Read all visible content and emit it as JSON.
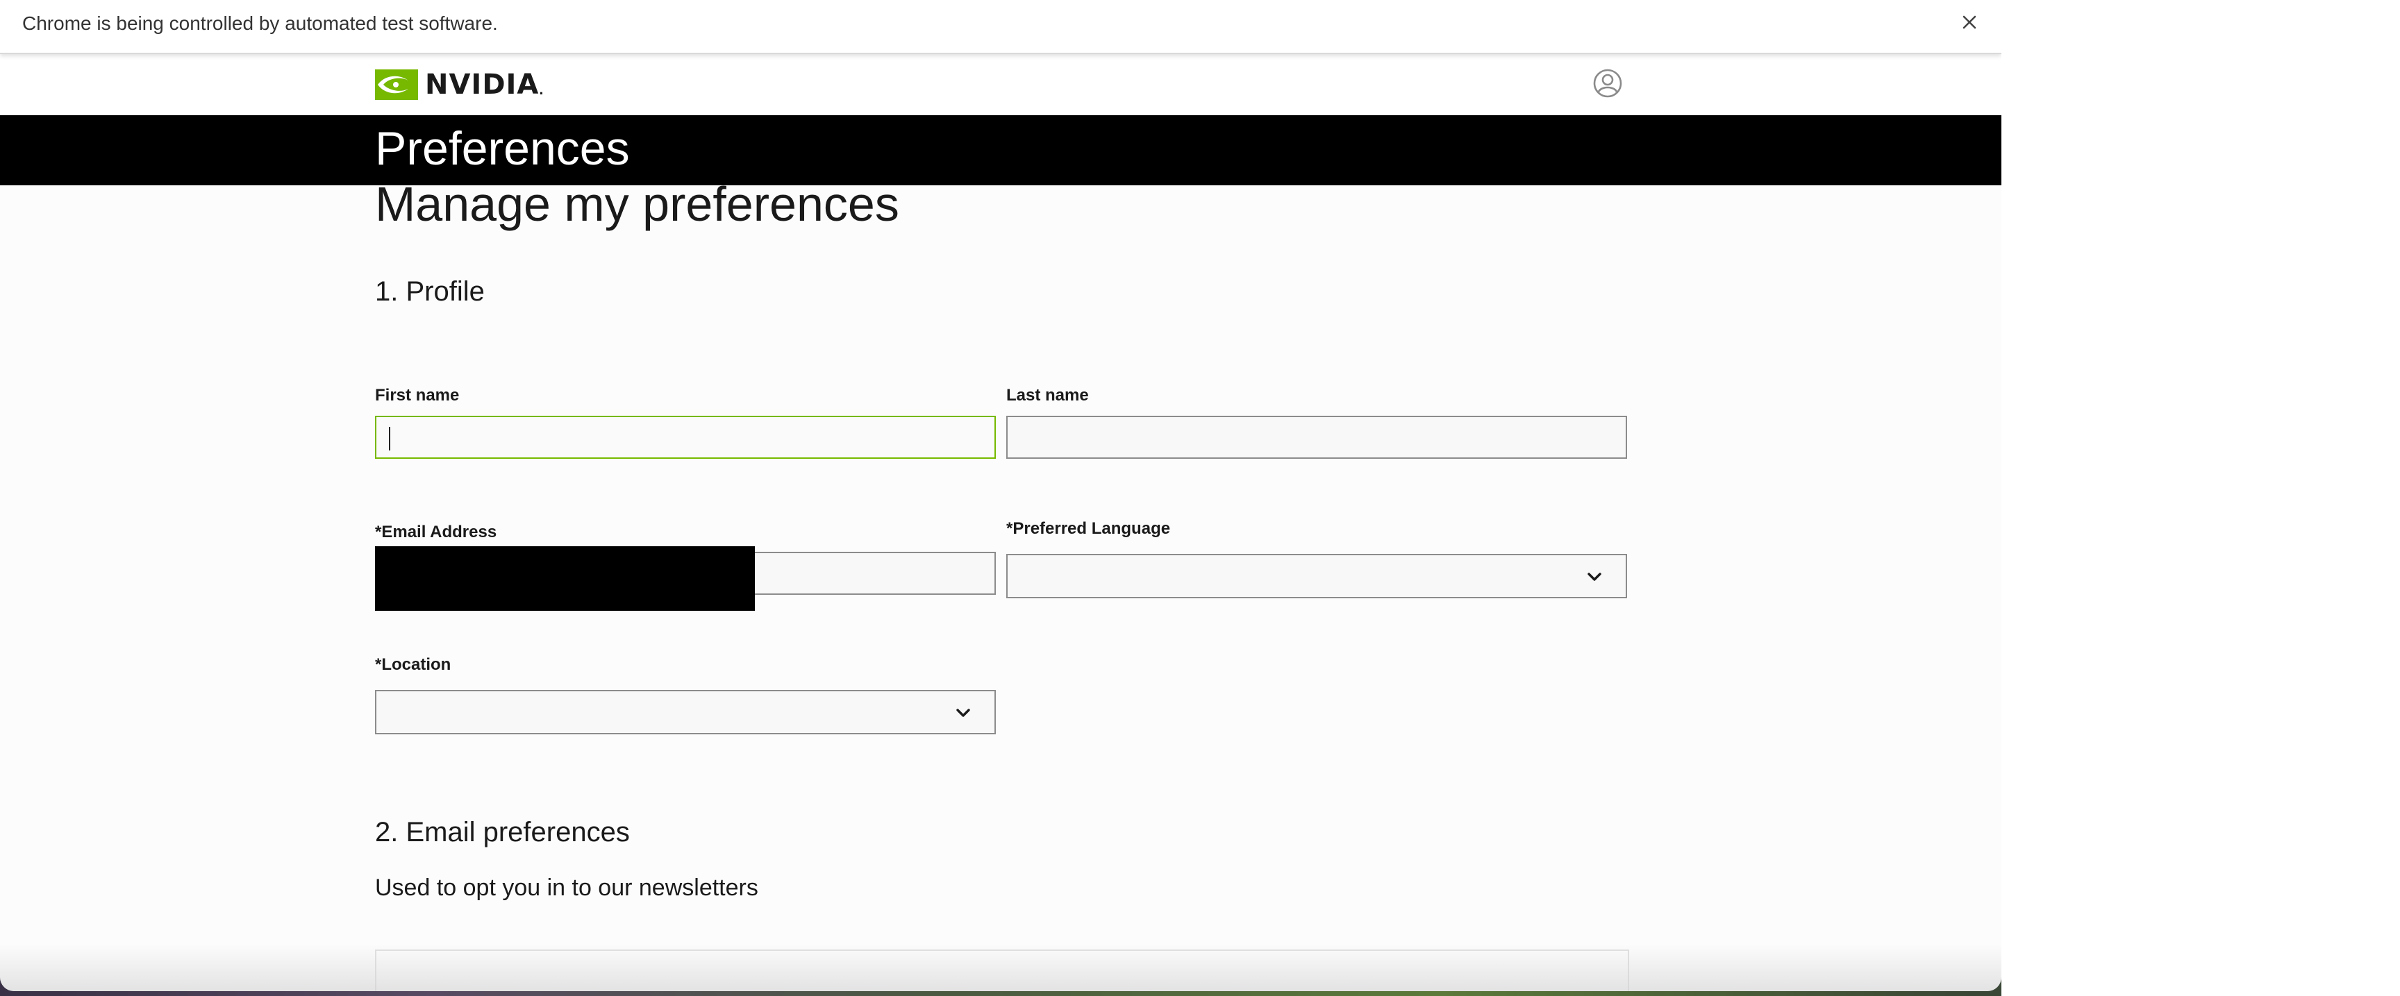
{
  "browser": {
    "infobar_text": "Chrome is being controlled by automated test software.",
    "close_icon": "close-icon"
  },
  "header": {
    "logo_text": "NVIDIA",
    "logo_dot": ".",
    "logo_icon": "nvidia-eye-icon",
    "account_icon": "user-account-icon",
    "brand_color": "#76b900"
  },
  "banner": {
    "title": "Preferences"
  },
  "page": {
    "title": "Manage my preferences"
  },
  "profile": {
    "section_title": "1. Profile",
    "first_name_label": "First name",
    "first_name_value": "",
    "last_name_label": "Last name",
    "last_name_value": "",
    "email_label": "*Email Address",
    "email_value": "",
    "language_label": "*Preferred Language",
    "language_value": "",
    "location_label": "*Location",
    "location_value": ""
  },
  "email_preferences": {
    "section_title": "2. Email preferences",
    "description": "Used to opt you in to our newsletters"
  }
}
